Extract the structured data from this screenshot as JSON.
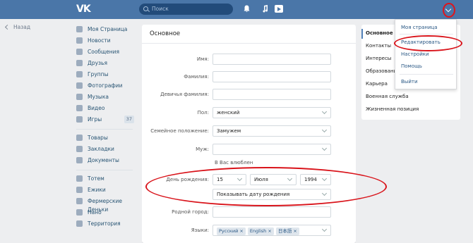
{
  "topbar": {
    "logo": "VK",
    "search_placeholder": "Поиск"
  },
  "back_label": "Назад",
  "leftnav": {
    "group1": [
      {
        "label": "Моя Страница",
        "icon": "home-icon"
      },
      {
        "label": "Новости",
        "icon": "news-icon"
      },
      {
        "label": "Сообщения",
        "icon": "messages-icon"
      },
      {
        "label": "Друзья",
        "icon": "friends-icon"
      },
      {
        "label": "Группы",
        "icon": "groups-icon"
      },
      {
        "label": "Фотографии",
        "icon": "photos-icon"
      },
      {
        "label": "Музыка",
        "icon": "music-icon"
      },
      {
        "label": "Видео",
        "icon": "video-icon"
      },
      {
        "label": "Игры",
        "icon": "games-icon",
        "count": "37"
      }
    ],
    "group2": [
      {
        "label": "Товары",
        "icon": "goods-icon"
      },
      {
        "label": "Закладки",
        "icon": "bookmarks-icon"
      },
      {
        "label": "Документы",
        "icon": "documents-icon"
      }
    ],
    "group3": [
      {
        "label": "Тотем",
        "icon": "app-icon"
      },
      {
        "label": "Ежики",
        "icon": "app-icon"
      },
      {
        "label": "Фермерские Деньки",
        "icon": "app-icon"
      },
      {
        "label": "Нано",
        "icon": "app-icon"
      },
      {
        "label": "Территория",
        "icon": "app-icon"
      }
    ]
  },
  "form": {
    "title": "Основное",
    "first_name_label": "Имя:",
    "last_name_label": "Фамилия:",
    "maiden_name_label": "Девичья фамилия:",
    "gender_label": "Пол:",
    "gender_value": "женский",
    "marital_label": "Семейное положение:",
    "marital_value": "Замужем",
    "husband_label": "Муж:",
    "in_love_text": "В Вас влюблен",
    "birthday_label": "День рождения:",
    "birth_day": "15",
    "birth_month": "Июля",
    "birth_year": "1994",
    "birthday_visibility": "Показывать дату рождения",
    "hometown_label": "Родной город:",
    "languages_label": "Языки:",
    "languages": [
      "Русский",
      "English",
      "日本語"
    ]
  },
  "subnav": {
    "items": [
      "Основное",
      "Контакты",
      "Интересы",
      "Образование",
      "Карьера",
      "Военная служба",
      "Жизненная позиция"
    ]
  },
  "dropdown": {
    "items": [
      "Моя страница",
      "Редактировать",
      "Настройки",
      "Помощь",
      "Выйти"
    ]
  },
  "colors": {
    "header": "#4a76a8",
    "annotation": "#d9141b",
    "link": "#2a5885"
  }
}
